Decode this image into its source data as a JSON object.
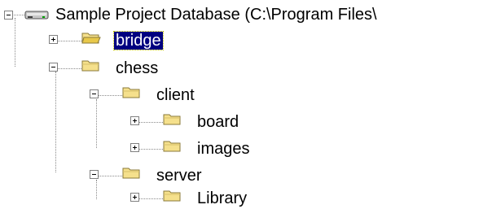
{
  "tree": {
    "root": {
      "label": "Sample Project Database (C:\\Program Files\\",
      "icon": "drive-icon",
      "expanded": true
    },
    "nodes": [
      {
        "id": "bridge",
        "label": "bridge",
        "icon": "folder-open-icon",
        "expanded": false,
        "selected": true
      },
      {
        "id": "chess",
        "label": "chess",
        "icon": "folder-icon",
        "expanded": true,
        "selected": false
      },
      {
        "id": "client",
        "label": "client",
        "icon": "folder-icon",
        "expanded": true,
        "selected": false
      },
      {
        "id": "board",
        "label": "board",
        "icon": "folder-icon",
        "expanded": false,
        "selected": false
      },
      {
        "id": "images",
        "label": "images",
        "icon": "folder-icon",
        "expanded": false,
        "selected": false
      },
      {
        "id": "server",
        "label": "server",
        "icon": "folder-icon",
        "expanded": true,
        "selected": false
      },
      {
        "id": "library",
        "label": "Library",
        "icon": "folder-icon",
        "expanded": false,
        "selected": false
      }
    ]
  },
  "colors": {
    "selection_bg": "#000080",
    "selection_fg": "#ffffff",
    "folder_fill": "#f5e08c",
    "folder_stroke": "#8a7a3a",
    "connector": "#8a8a8a"
  }
}
